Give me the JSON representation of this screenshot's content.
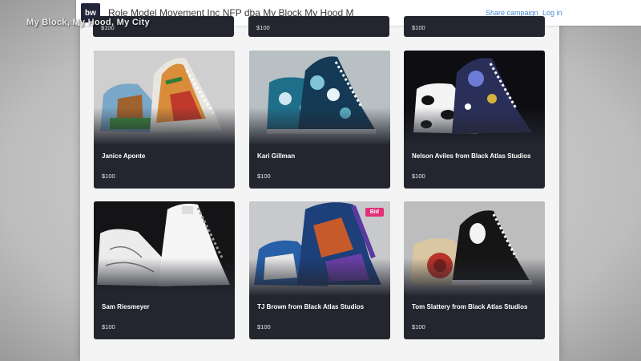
{
  "overlay": {
    "watermark": "My Block, My Hood, My City"
  },
  "header": {
    "logo_text": "bw",
    "title": "Role Model Movement Inc NFP dba My Block My Hood M",
    "share_label": "Share campaign",
    "login_label": "Log in"
  },
  "top_row_prices": [
    "$100",
    "$100",
    "$100"
  ],
  "cards": [
    {
      "title": "Janice Aponte",
      "price": "$100"
    },
    {
      "title": "Kari Gillman",
      "price": "$100"
    },
    {
      "title": "Nelson Aviles from Black Atlas Studios",
      "price": "$100"
    },
    {
      "title": "Sam Riesmeyer",
      "price": "$100"
    },
    {
      "title": "TJ Brown from Black Atlas Studios",
      "price": "$100",
      "badge": "Bid"
    },
    {
      "title": "Tom Slattery from Black Atlas Studios",
      "price": "$100"
    }
  ]
}
